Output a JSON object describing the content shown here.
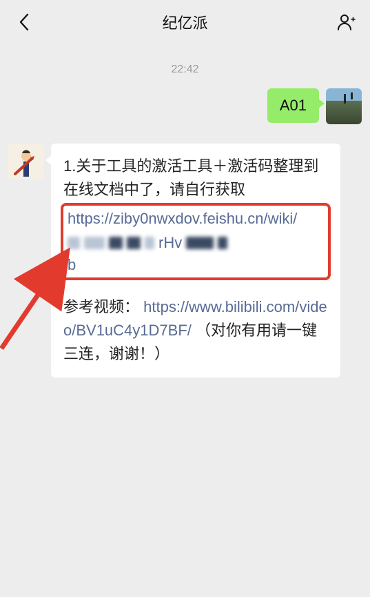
{
  "header": {
    "title": "纪亿派"
  },
  "timestamp": "22:42",
  "outgoing": {
    "text": "A01"
  },
  "incoming": {
    "line1": "1.关于工具的激活工具＋激活码整理到在线文档中了，请自行获取",
    "link1": "https://ziby0nwxdov.feishu.cn/wiki/",
    "blur_mid": "rHv",
    "blur_tail": "b",
    "ref_label": "参考视频：",
    "link2": "https://www.bilibili.com/video/BV1uC4y1D7BF/",
    "tail": "（对你有用请一键三连，谢谢！）"
  }
}
